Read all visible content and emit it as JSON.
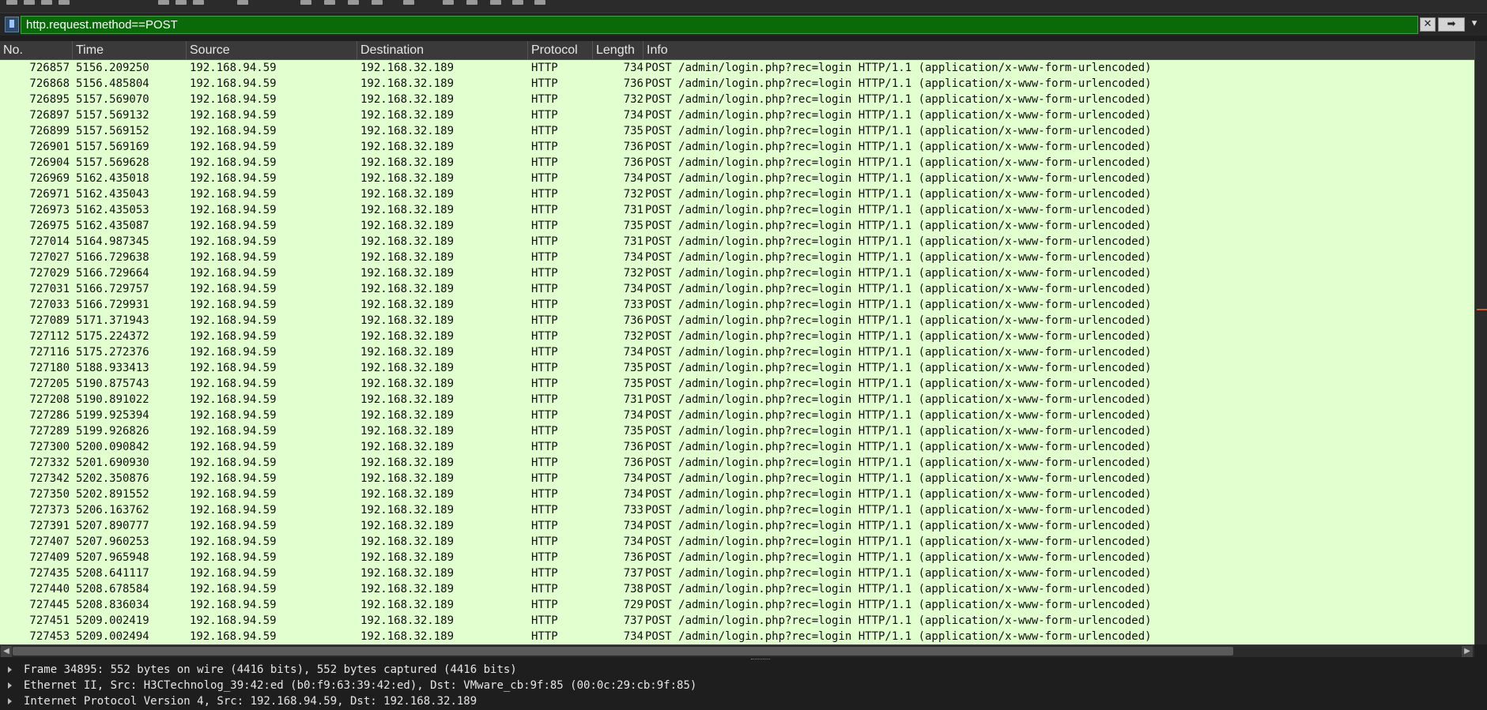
{
  "filter": {
    "value": "http.request.method==POST",
    "clear_label": "✕",
    "apply_label": "➡",
    "dropdown_label": "▾"
  },
  "columns": [
    "No.",
    "Time",
    "Source",
    "Destination",
    "Protocol",
    "Length",
    "Info"
  ],
  "packets": [
    [
      "726857",
      "5156.209250",
      "192.168.94.59",
      "192.168.32.189",
      "HTTP",
      "734",
      "POST /admin/login.php?rec=login HTTP/1.1  (application/x-www-form-urlencoded)"
    ],
    [
      "726868",
      "5156.485804",
      "192.168.94.59",
      "192.168.32.189",
      "HTTP",
      "736",
      "POST /admin/login.php?rec=login HTTP/1.1  (application/x-www-form-urlencoded)"
    ],
    [
      "726895",
      "5157.569070",
      "192.168.94.59",
      "192.168.32.189",
      "HTTP",
      "732",
      "POST /admin/login.php?rec=login HTTP/1.1  (application/x-www-form-urlencoded)"
    ],
    [
      "726897",
      "5157.569132",
      "192.168.94.59",
      "192.168.32.189",
      "HTTP",
      "734",
      "POST /admin/login.php?rec=login HTTP/1.1  (application/x-www-form-urlencoded)"
    ],
    [
      "726899",
      "5157.569152",
      "192.168.94.59",
      "192.168.32.189",
      "HTTP",
      "735",
      "POST /admin/login.php?rec=login HTTP/1.1  (application/x-www-form-urlencoded)"
    ],
    [
      "726901",
      "5157.569169",
      "192.168.94.59",
      "192.168.32.189",
      "HTTP",
      "736",
      "POST /admin/login.php?rec=login HTTP/1.1  (application/x-www-form-urlencoded)"
    ],
    [
      "726904",
      "5157.569628",
      "192.168.94.59",
      "192.168.32.189",
      "HTTP",
      "736",
      "POST /admin/login.php?rec=login HTTP/1.1  (application/x-www-form-urlencoded)"
    ],
    [
      "726969",
      "5162.435018",
      "192.168.94.59",
      "192.168.32.189",
      "HTTP",
      "734",
      "POST /admin/login.php?rec=login HTTP/1.1  (application/x-www-form-urlencoded)"
    ],
    [
      "726971",
      "5162.435043",
      "192.168.94.59",
      "192.168.32.189",
      "HTTP",
      "732",
      "POST /admin/login.php?rec=login HTTP/1.1  (application/x-www-form-urlencoded)"
    ],
    [
      "726973",
      "5162.435053",
      "192.168.94.59",
      "192.168.32.189",
      "HTTP",
      "731",
      "POST /admin/login.php?rec=login HTTP/1.1  (application/x-www-form-urlencoded)"
    ],
    [
      "726975",
      "5162.435087",
      "192.168.94.59",
      "192.168.32.189",
      "HTTP",
      "735",
      "POST /admin/login.php?rec=login HTTP/1.1  (application/x-www-form-urlencoded)"
    ],
    [
      "727014",
      "5164.987345",
      "192.168.94.59",
      "192.168.32.189",
      "HTTP",
      "731",
      "POST /admin/login.php?rec=login HTTP/1.1  (application/x-www-form-urlencoded)"
    ],
    [
      "727027",
      "5166.729638",
      "192.168.94.59",
      "192.168.32.189",
      "HTTP",
      "734",
      "POST /admin/login.php?rec=login HTTP/1.1  (application/x-www-form-urlencoded)"
    ],
    [
      "727029",
      "5166.729664",
      "192.168.94.59",
      "192.168.32.189",
      "HTTP",
      "732",
      "POST /admin/login.php?rec=login HTTP/1.1  (application/x-www-form-urlencoded)"
    ],
    [
      "727031",
      "5166.729757",
      "192.168.94.59",
      "192.168.32.189",
      "HTTP",
      "734",
      "POST /admin/login.php?rec=login HTTP/1.1  (application/x-www-form-urlencoded)"
    ],
    [
      "727033",
      "5166.729931",
      "192.168.94.59",
      "192.168.32.189",
      "HTTP",
      "733",
      "POST /admin/login.php?rec=login HTTP/1.1  (application/x-www-form-urlencoded)"
    ],
    [
      "727089",
      "5171.371943",
      "192.168.94.59",
      "192.168.32.189",
      "HTTP",
      "736",
      "POST /admin/login.php?rec=login HTTP/1.1  (application/x-www-form-urlencoded)"
    ],
    [
      "727112",
      "5175.224372",
      "192.168.94.59",
      "192.168.32.189",
      "HTTP",
      "732",
      "POST /admin/login.php?rec=login HTTP/1.1  (application/x-www-form-urlencoded)"
    ],
    [
      "727116",
      "5175.272376",
      "192.168.94.59",
      "192.168.32.189",
      "HTTP",
      "734",
      "POST /admin/login.php?rec=login HTTP/1.1  (application/x-www-form-urlencoded)"
    ],
    [
      "727180",
      "5188.933413",
      "192.168.94.59",
      "192.168.32.189",
      "HTTP",
      "735",
      "POST /admin/login.php?rec=login HTTP/1.1  (application/x-www-form-urlencoded)"
    ],
    [
      "727205",
      "5190.875743",
      "192.168.94.59",
      "192.168.32.189",
      "HTTP",
      "735",
      "POST /admin/login.php?rec=login HTTP/1.1  (application/x-www-form-urlencoded)"
    ],
    [
      "727208",
      "5190.891022",
      "192.168.94.59",
      "192.168.32.189",
      "HTTP",
      "731",
      "POST /admin/login.php?rec=login HTTP/1.1  (application/x-www-form-urlencoded)"
    ],
    [
      "727286",
      "5199.925394",
      "192.168.94.59",
      "192.168.32.189",
      "HTTP",
      "734",
      "POST /admin/login.php?rec=login HTTP/1.1  (application/x-www-form-urlencoded)"
    ],
    [
      "727289",
      "5199.926826",
      "192.168.94.59",
      "192.168.32.189",
      "HTTP",
      "735",
      "POST /admin/login.php?rec=login HTTP/1.1  (application/x-www-form-urlencoded)"
    ],
    [
      "727300",
      "5200.090842",
      "192.168.94.59",
      "192.168.32.189",
      "HTTP",
      "736",
      "POST /admin/login.php?rec=login HTTP/1.1  (application/x-www-form-urlencoded)"
    ],
    [
      "727332",
      "5201.690930",
      "192.168.94.59",
      "192.168.32.189",
      "HTTP",
      "736",
      "POST /admin/login.php?rec=login HTTP/1.1  (application/x-www-form-urlencoded)"
    ],
    [
      "727342",
      "5202.350876",
      "192.168.94.59",
      "192.168.32.189",
      "HTTP",
      "734",
      "POST /admin/login.php?rec=login HTTP/1.1  (application/x-www-form-urlencoded)"
    ],
    [
      "727350",
      "5202.891552",
      "192.168.94.59",
      "192.168.32.189",
      "HTTP",
      "734",
      "POST /admin/login.php?rec=login HTTP/1.1  (application/x-www-form-urlencoded)"
    ],
    [
      "727373",
      "5206.163762",
      "192.168.94.59",
      "192.168.32.189",
      "HTTP",
      "733",
      "POST /admin/login.php?rec=login HTTP/1.1  (application/x-www-form-urlencoded)"
    ],
    [
      "727391",
      "5207.890777",
      "192.168.94.59",
      "192.168.32.189",
      "HTTP",
      "734",
      "POST /admin/login.php?rec=login HTTP/1.1  (application/x-www-form-urlencoded)"
    ],
    [
      "727407",
      "5207.960253",
      "192.168.94.59",
      "192.168.32.189",
      "HTTP",
      "734",
      "POST /admin/login.php?rec=login HTTP/1.1  (application/x-www-form-urlencoded)"
    ],
    [
      "727409",
      "5207.965948",
      "192.168.94.59",
      "192.168.32.189",
      "HTTP",
      "736",
      "POST /admin/login.php?rec=login HTTP/1.1  (application/x-www-form-urlencoded)"
    ],
    [
      "727435",
      "5208.641117",
      "192.168.94.59",
      "192.168.32.189",
      "HTTP",
      "737",
      "POST /admin/login.php?rec=login HTTP/1.1  (application/x-www-form-urlencoded)"
    ],
    [
      "727440",
      "5208.678584",
      "192.168.94.59",
      "192.168.32.189",
      "HTTP",
      "738",
      "POST /admin/login.php?rec=login HTTP/1.1  (application/x-www-form-urlencoded)"
    ],
    [
      "727445",
      "5208.836034",
      "192.168.94.59",
      "192.168.32.189",
      "HTTP",
      "729",
      "POST /admin/login.php?rec=login HTTP/1.1  (application/x-www-form-urlencoded)"
    ],
    [
      "727451",
      "5209.002419",
      "192.168.94.59",
      "192.168.32.189",
      "HTTP",
      "737",
      "POST /admin/login.php?rec=login HTTP/1.1  (application/x-www-form-urlencoded)"
    ],
    [
      "727453",
      "5209.002494",
      "192.168.94.59",
      "192.168.32.189",
      "HTTP",
      "734",
      "POST /admin/login.php?rec=login HTTP/1.1  (application/x-www-form-urlencoded)"
    ]
  ],
  "details": [
    "Frame 34895: 552 bytes on wire (4416 bits), 552 bytes captured (4416 bits)",
    "Ethernet II, Src: H3CTechnolog_39:42:ed (b0:f9:63:39:42:ed), Dst: VMware_cb:9f:85 (00:0c:29:cb:9f:85)",
    "Internet Protocol Version 4, Src: 192.168.94.59, Dst: 192.168.32.189"
  ],
  "icons": {
    "bookmark": "filter-bookmark-icon",
    "clear": "clear-filter-icon",
    "apply": "apply-filter-icon",
    "expand": "expand-arrow-icon"
  },
  "colors": {
    "filter_valid_bg": "#0a6a0a",
    "row_bg": "#e2ffcf",
    "header_bg": "#3a3a3a"
  }
}
